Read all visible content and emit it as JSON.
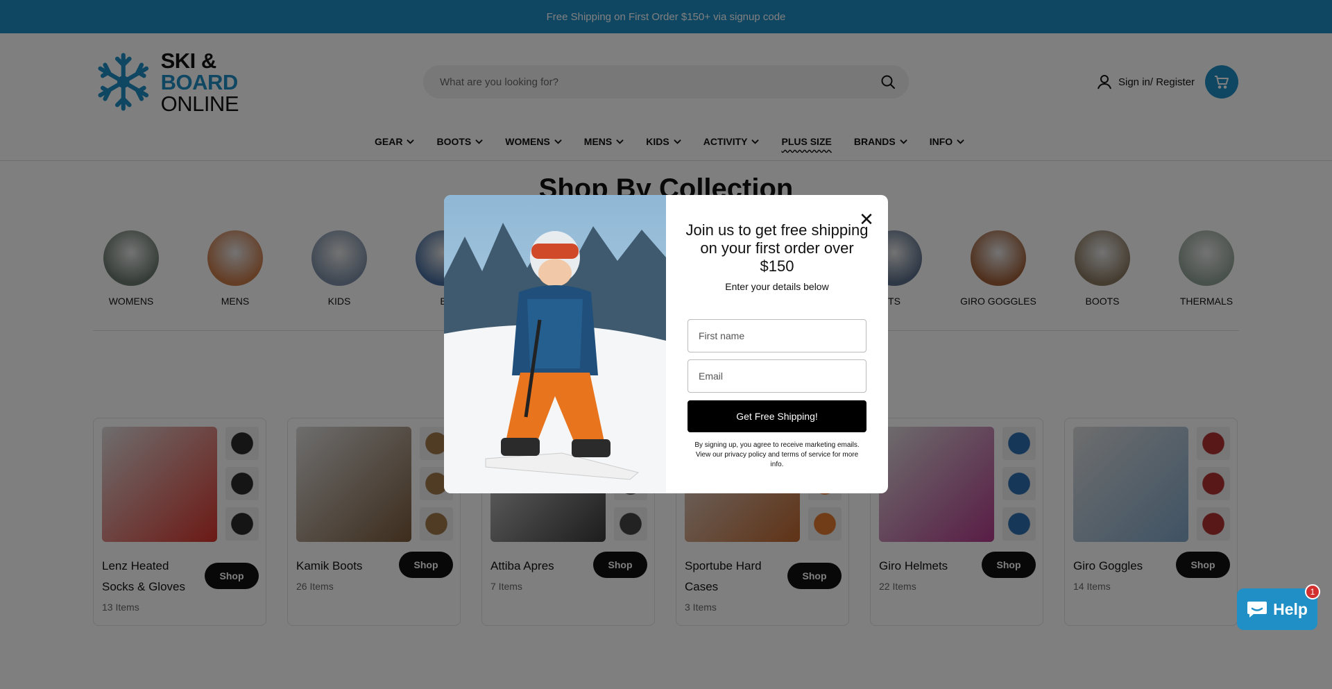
{
  "announcement": {
    "text": "Free Shipping on First Order $150+ via signup code"
  },
  "logo": {
    "line1": "SKI &",
    "line2": "BOARD",
    "line3": "ONLINE"
  },
  "search": {
    "placeholder": "What are you looking for?"
  },
  "account": {
    "signin_label": "Sign in/ Register"
  },
  "nav": {
    "items": [
      {
        "label": "GEAR"
      },
      {
        "label": "BOOTS"
      },
      {
        "label": "WOMENS"
      },
      {
        "label": "MENS"
      },
      {
        "label": "KIDS"
      },
      {
        "label": "ACTIVITY"
      },
      {
        "label": "PLUS SIZE"
      },
      {
        "label": "BRANDS"
      },
      {
        "label": "INFO"
      }
    ]
  },
  "collections": {
    "title": "Shop By Collection",
    "items": [
      {
        "name": "WOMENS",
        "color": "#6b7a70"
      },
      {
        "name": "MENS",
        "color": "#c97a4a"
      },
      {
        "name": "KIDS",
        "color": "#7c8ea6"
      },
      {
        "name": "B",
        "color": "#4a6fa0"
      },
      {
        "name": "TS",
        "color": "#5a6e8a"
      },
      {
        "name": "GIRO GOGGLES",
        "color": "#a0603a"
      },
      {
        "name": "BOOTS",
        "color": "#8c7a62"
      },
      {
        "name": "THERMALS",
        "color": "#93a398"
      }
    ]
  },
  "products": {
    "shop_label": "Shop",
    "items": [
      {
        "title": "Lenz Heated Socks & Gloves",
        "count": "13 Items",
        "color": "#d9342b",
        "thumb_color": "#2a2a2a"
      },
      {
        "title": "Kamik Boots",
        "count": "26 Items",
        "color": "#7a5a3a",
        "thumb_color": "#a0784a"
      },
      {
        "title": "Attiba Apres",
        "count": "7 Items",
        "color": "#3a3a3a",
        "thumb_color": "#444444"
      },
      {
        "title": "Sportube Hard Cases",
        "count": "3 Items",
        "color": "#c0662c",
        "thumb_color": "#e07a30"
      },
      {
        "title": "Giro Helmets",
        "count": "22 Items",
        "color": "#b23a8c",
        "thumb_color": "#2f6fb0"
      },
      {
        "title": "Giro Goggles",
        "count": "14 Items",
        "color": "#7fa6c8",
        "thumb_color": "#b03030"
      }
    ]
  },
  "popup": {
    "headline": "Join us to get free shipping on your first order over $150",
    "subtext": "Enter your details below",
    "first_name_placeholder": "First name",
    "email_placeholder": "Email",
    "submit_label": "Get Free Shipping!",
    "legal": "By signing up, you agree to receive marketing emails. View our privacy policy and terms of service for more info.",
    "close_symbol": "✕"
  },
  "chat": {
    "label": "Help",
    "badge": "1"
  },
  "colors": {
    "brand": "#1f8fc6",
    "dark": "#111111"
  }
}
